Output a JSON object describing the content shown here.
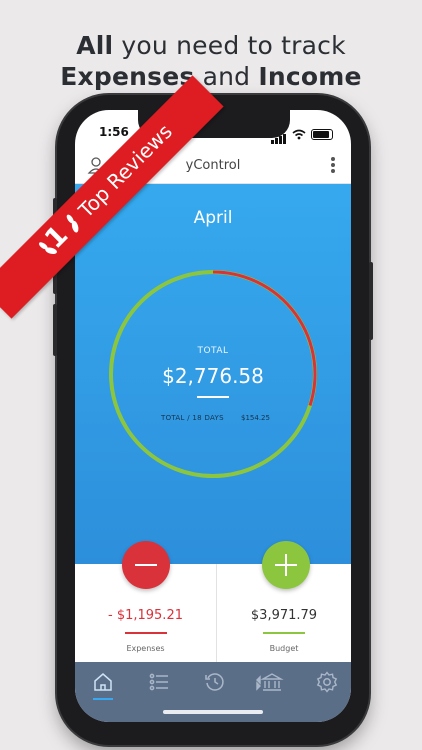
{
  "headline": {
    "line1_bold": "All",
    "line1_rest": " you need to track",
    "line2_bold1": "Expenses",
    "line2_mid": " and ",
    "line2_bold2": "Income"
  },
  "status_bar": {
    "time": "1:56"
  },
  "app": {
    "title": "yControl"
  },
  "ribbon": {
    "rank": "1",
    "text": "Top Reviews"
  },
  "summary": {
    "month": "April",
    "total_label": "TOTAL",
    "total_value": "$2,776.58",
    "days_label": "TOTAL / 18 DAYS",
    "days_value": "$154.25",
    "ring_fraction_spent": 0.3
  },
  "cards": {
    "expenses_value": "- $1,195.21",
    "expenses_label": "Expenses",
    "budget_value": "$3,971.79",
    "budget_label": "Budget"
  },
  "tabs": [
    "home-icon",
    "list-icon",
    "history-icon",
    "bank-icon",
    "gear-icon"
  ],
  "colors": {
    "blue": "#36a9ee",
    "red": "#d9323a",
    "green": "#8cc63f",
    "tabbar": "#5b6e88",
    "ribbon": "#dd1d22"
  }
}
